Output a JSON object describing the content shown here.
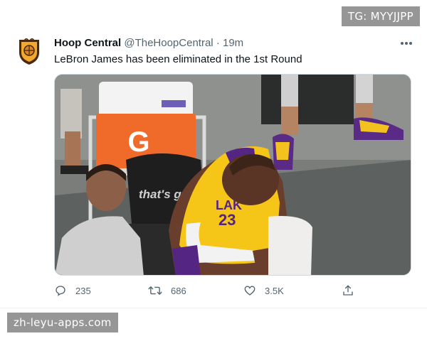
{
  "tweet": {
    "author_name": "Hoop Central",
    "handle": "@TheHoopCentral",
    "separator": "·",
    "time": "19m",
    "text": "LeBron James has been eliminated in the 1st Round",
    "more_icon": "more-dots-icon"
  },
  "media": {
    "cooler_brand": "G",
    "seat_text": "that's g",
    "jersey_text": "LAK",
    "jersey_number": "23"
  },
  "actions": {
    "reply_count": "235",
    "retweet_count": "686",
    "like_count": "3.5K"
  },
  "watermarks": {
    "top": "TG: MYYJJPP",
    "bottom": "zh-leyu-apps.com"
  },
  "colors": {
    "text": "#0f1419",
    "muted": "#536471",
    "lakers_gold": "#f5c518",
    "lakers_purple": "#552583",
    "gatorade_orange": "#f06a2a"
  }
}
